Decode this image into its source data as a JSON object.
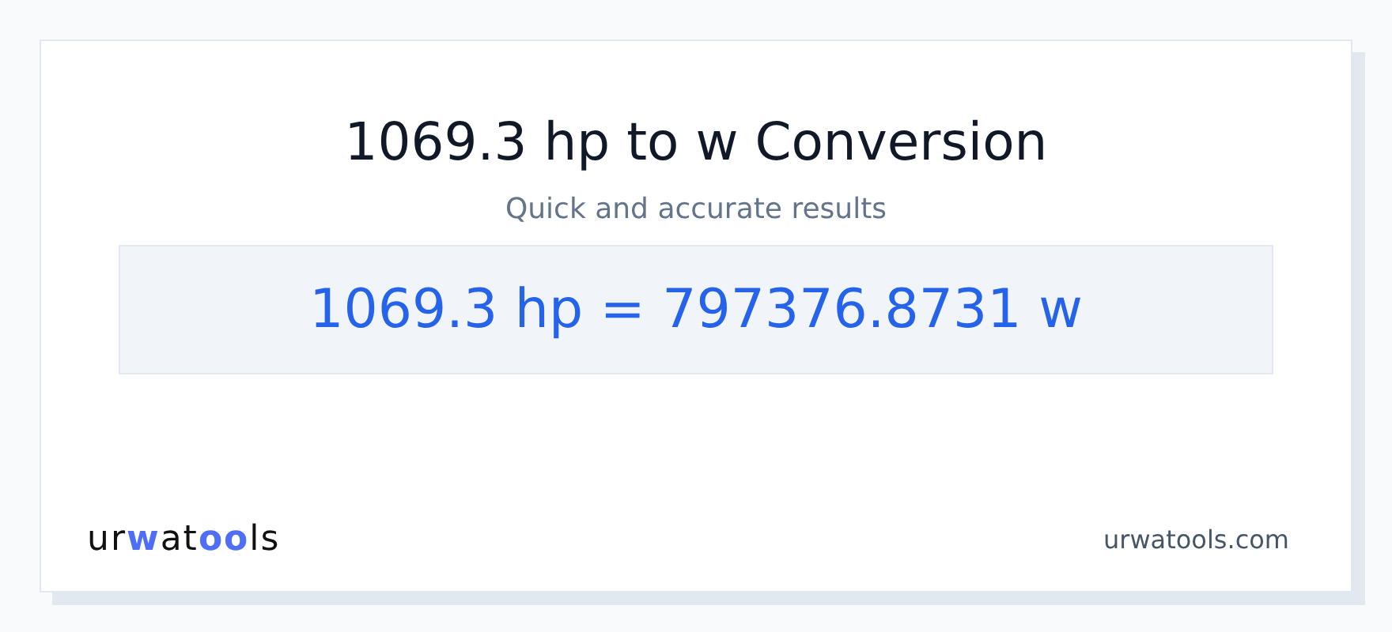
{
  "title": "1069.3 hp to w Conversion",
  "subtitle": "Quick and accurate results",
  "result": "1069.3 hp = 797376.8731 w",
  "logo": [
    {
      "text": "ur",
      "accent": false
    },
    {
      "text": "w",
      "accent": true
    },
    {
      "text": "at",
      "accent": false
    },
    {
      "text": "oo",
      "accent": true
    },
    {
      "text": "ls",
      "accent": false
    }
  ],
  "site": "urwatools.com"
}
